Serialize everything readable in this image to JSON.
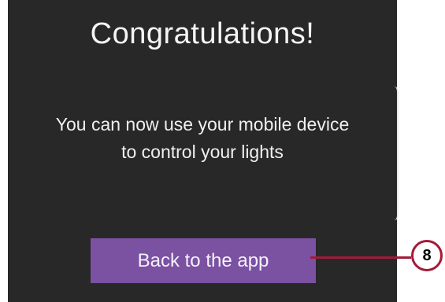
{
  "screen": {
    "title": "Congratulations!",
    "message_line1": "You can now use your mobile device",
    "message_line2": "to control your lights",
    "back_button_label": "Back to the app"
  },
  "callout": {
    "number": "8"
  },
  "colors": {
    "background": "#282828",
    "button": "#7b51a2",
    "callout": "#a01c3a"
  }
}
